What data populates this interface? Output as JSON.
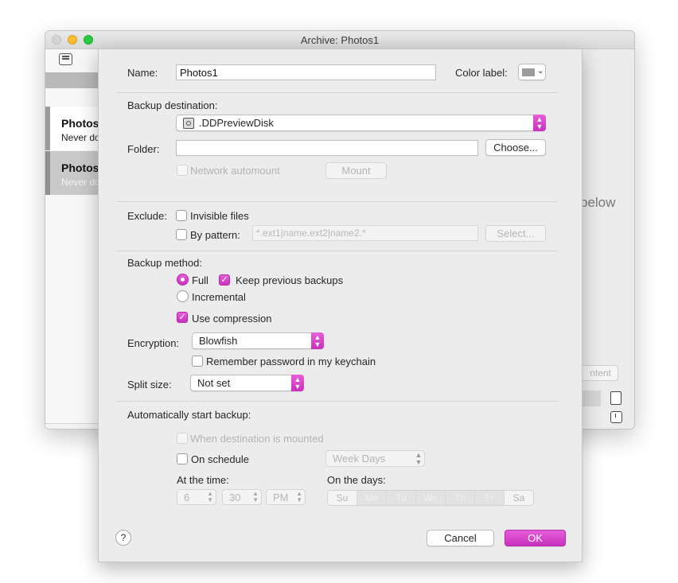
{
  "window": {
    "title": "Archive: Photos1"
  },
  "sidebar": {
    "items": [
      {
        "name": "Photos",
        "subtitle": "Never do"
      },
      {
        "name": "Photos",
        "subtitle": "Never do"
      }
    ],
    "add_label": "+",
    "remove_label": "−"
  },
  "background": {
    "below_text": "below",
    "content_button": "ntent"
  },
  "sheet": {
    "name_label": "Name:",
    "name_value": "Photos1",
    "color_label": "Color label:",
    "color_swatch": "#9b9b9b",
    "backup_destination_label": "Backup destination:",
    "destination_value": ".DDPreviewDisk",
    "folder_label": "Folder:",
    "folder_value": "",
    "choose_button": "Choose...",
    "network_automount_label": "Network automount",
    "mount_button": "Mount",
    "exclude_label": "Exclude:",
    "invisible_files_label": "Invisible files",
    "by_pattern_label": "By pattern:",
    "pattern_placeholder": "*.ext1|name.ext2|name2.*",
    "select_button": "Select...",
    "backup_method_label": "Backup method:",
    "full_label": "Full",
    "keep_previous_label": "Keep previous backups",
    "incremental_label": "Incremental",
    "use_compression_label": "Use compression",
    "encryption_label": "Encryption:",
    "encryption_value": "Blowfish",
    "remember_password_label": "Remember password in my keychain",
    "split_size_label": "Split size:",
    "split_size_value": "Not set",
    "auto_start_label": "Automatically start backup:",
    "when_mounted_label": "When destination is mounted",
    "on_schedule_label": "On schedule",
    "schedule_value": "Week Days",
    "at_time_label": "At the time:",
    "hour": "6",
    "minute": "30",
    "ampm": "PM",
    "on_days_label": "On the days:",
    "days": [
      "Su",
      "Mo",
      "Tu",
      "We",
      "Th",
      "Fr",
      "Sa"
    ],
    "help_label": "?",
    "cancel_button": "Cancel",
    "ok_button": "OK",
    "accent_color": "#d63fca"
  }
}
